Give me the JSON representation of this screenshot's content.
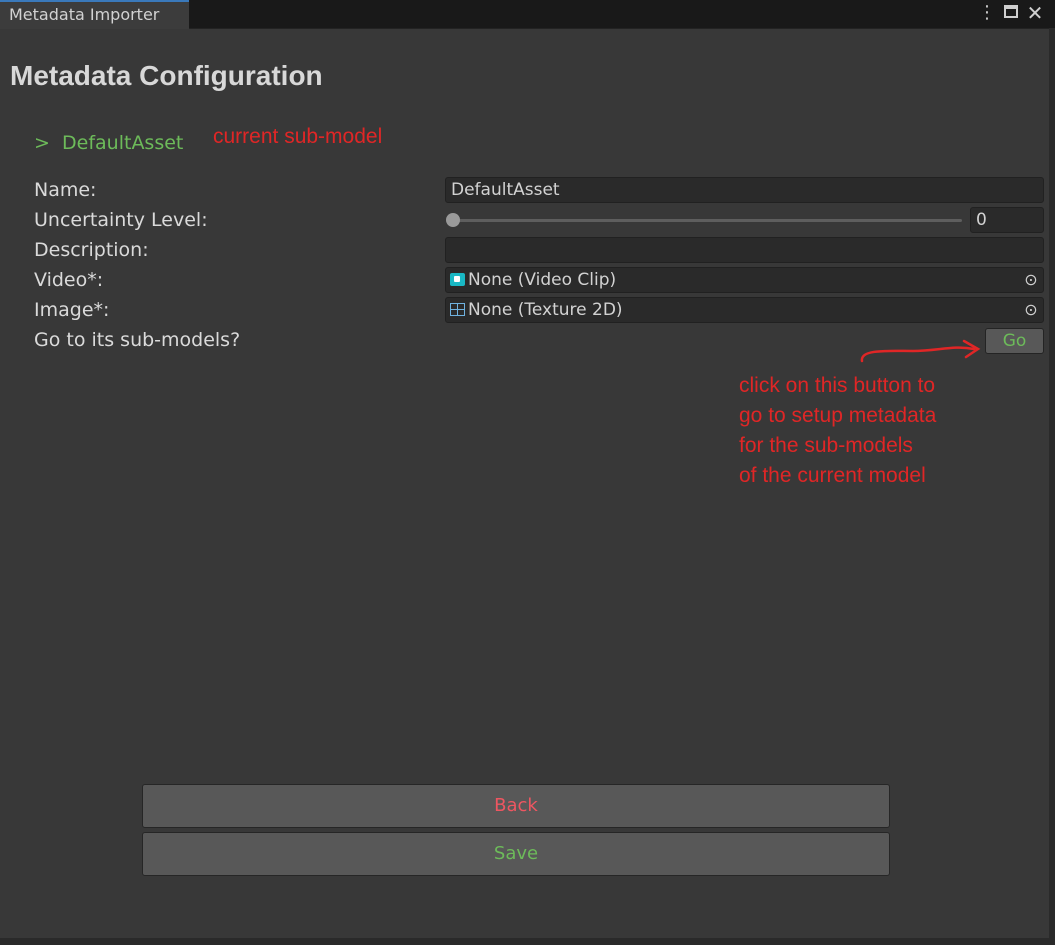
{
  "window": {
    "tab_title": "Metadata Importer",
    "menu_icon": "vertical-dots-icon",
    "maximize_icon": "maximize-icon",
    "close_icon": "close-icon"
  },
  "page_title": "Metadata Configuration",
  "breadcrumb": {
    "prefix": ">",
    "label": "DefaultAsset"
  },
  "annotations": {
    "current_submodel": "current sub-model",
    "go_hint": [
      "click on this button to",
      "go to setup metadata",
      "for the sub-models",
      "of the current model"
    ]
  },
  "form": {
    "name_label": "Name:",
    "name_value": "DefaultAsset",
    "uncertainty_label": "Uncertainty Level:",
    "uncertainty_value": "0",
    "uncertainty_fraction": 0,
    "description_label": "Description:",
    "description_value": "",
    "video_label": "Video*:",
    "video_value": "None (Video Clip)",
    "image_label": "Image*:",
    "image_value": "None (Texture 2D)",
    "submodels_label": "Go to its sub-models?",
    "go_label": "Go"
  },
  "buttons": {
    "back": "Back",
    "save": "Save"
  },
  "colors": {
    "accent_green": "#6dbb5a",
    "annotation_red": "#e02626",
    "back_red": "#ee5661",
    "background": "#383838"
  }
}
